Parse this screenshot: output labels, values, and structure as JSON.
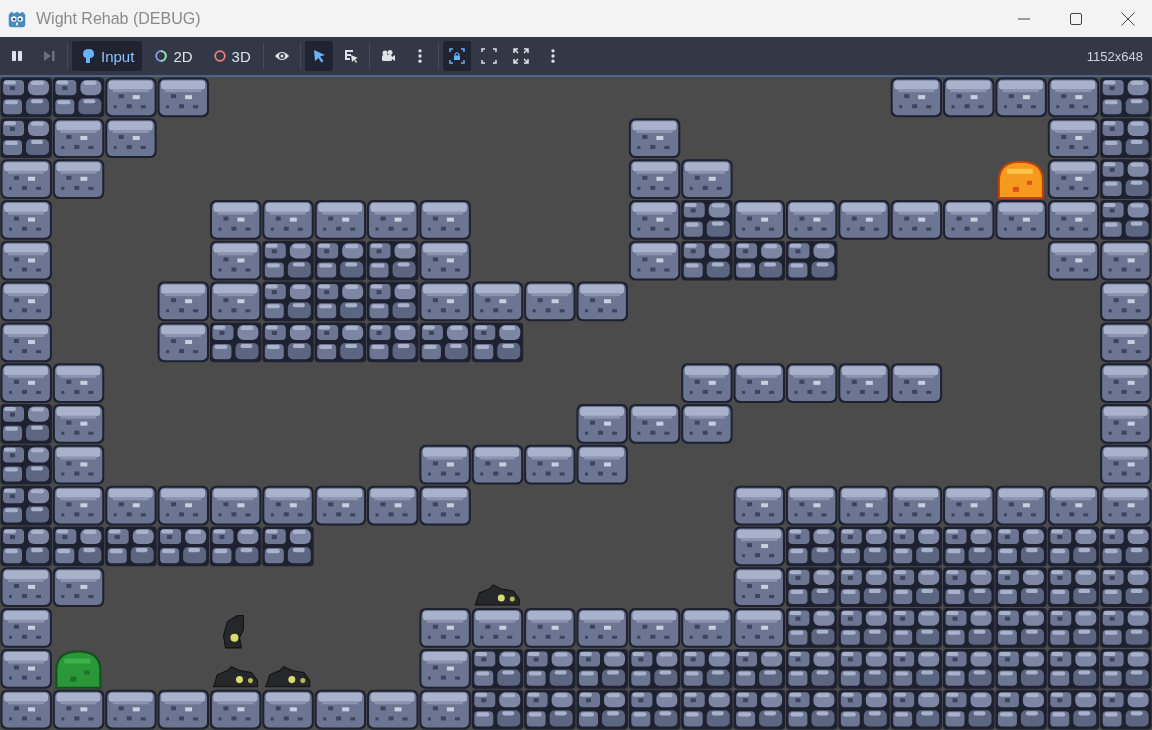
{
  "window": {
    "title": "Wight Rehab (DEBUG)"
  },
  "toolbar": {
    "groups": [
      [
        {
          "kind": "pause",
          "selected": false,
          "disabled": false
        },
        {
          "kind": "step",
          "selected": false,
          "disabled": true
        }
      ],
      [
        {
          "kind": "input",
          "label": "Input",
          "selected": true,
          "disabled": false
        },
        {
          "kind": "scene2d",
          "label": "2D",
          "selected": false,
          "disabled": false
        },
        {
          "kind": "scene3d",
          "label": "3D",
          "selected": false,
          "disabled": false
        }
      ],
      [
        {
          "kind": "eye",
          "selected": false,
          "disabled": false
        }
      ],
      [
        {
          "kind": "select",
          "selected": true,
          "disabled": false
        },
        {
          "kind": "list-select",
          "selected": false,
          "disabled": false
        }
      ],
      [
        {
          "kind": "camera",
          "selected": false,
          "disabled": false
        },
        {
          "kind": "more",
          "selected": false,
          "disabled": false
        }
      ],
      [
        {
          "kind": "lock-frame",
          "selected": true,
          "disabled": false
        },
        {
          "kind": "shrink",
          "selected": false,
          "disabled": false
        },
        {
          "kind": "expand",
          "selected": false,
          "disabled": false
        },
        {
          "kind": "more",
          "selected": false,
          "disabled": false
        }
      ]
    ],
    "resolution": "1152x648"
  }
}
